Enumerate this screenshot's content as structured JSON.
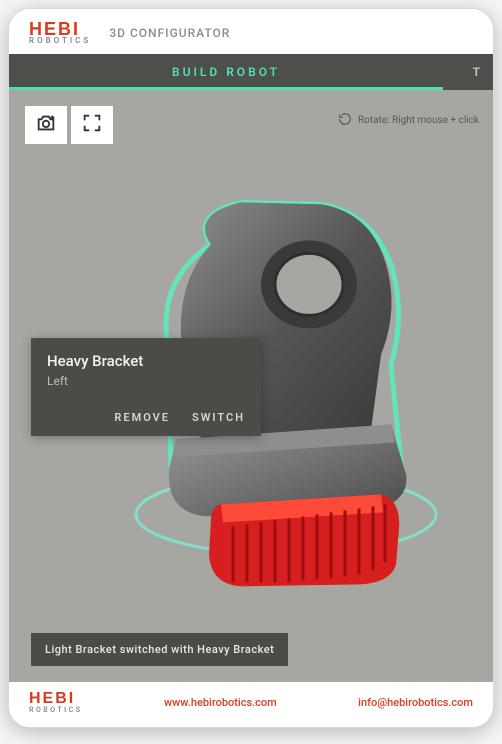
{
  "brand": {
    "main": "HEBI",
    "sub": "ROBOTICS",
    "accent_color": "#d63c1e",
    "highlight_color": "#4fe0b0"
  },
  "header": {
    "title": "3D CONFIGURATOR"
  },
  "tabs": {
    "active": "BUILD ROBOT",
    "truncated": "T"
  },
  "viewport": {
    "rotate_hint": "Rotate: Right mouse + click"
  },
  "popover": {
    "title": "Heavy Bracket",
    "subtitle": "Left",
    "remove_label": "REMOVE",
    "switch_label": "SWITCH"
  },
  "toast": {
    "message": "Light Bracket switched with Heavy Bracket"
  },
  "footer": {
    "website": "www.hebirobotics.com",
    "email": "info@hebirobotics.com"
  }
}
